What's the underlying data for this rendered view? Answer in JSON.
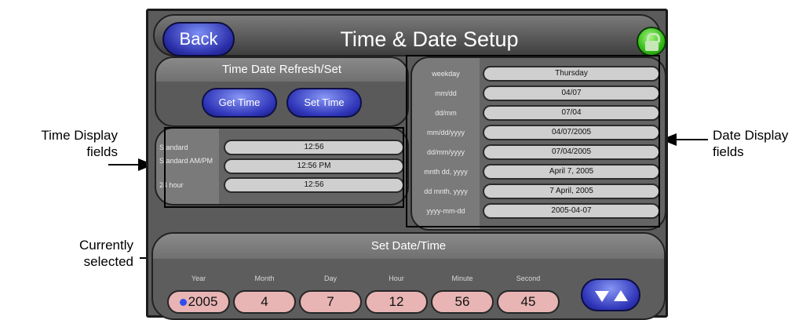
{
  "titlebar": {
    "back_label": "Back",
    "title": "Time & Date Setup",
    "lock_icon": "padlock-icon"
  },
  "refresh_panel": {
    "title": "Time Date Refresh/Set",
    "get_time_label": "Get Time",
    "set_time_label": "Set Time"
  },
  "time_display": {
    "rows": [
      {
        "label": "Standard",
        "value": "12:56"
      },
      {
        "label": "Standard AM/PM",
        "value": "12:56 PM"
      },
      {
        "label": "24 hour",
        "value": "12:56"
      }
    ]
  },
  "date_display": {
    "rows": [
      {
        "label": "weekday",
        "value": "Thursday"
      },
      {
        "label": "mm/dd",
        "value": "04/07"
      },
      {
        "label": "dd/mm",
        "value": "07/04"
      },
      {
        "label": "mm/dd/yyyy",
        "value": "04/07/2005"
      },
      {
        "label": "dd/mm/yyyy",
        "value": "07/04/2005"
      },
      {
        "label": "mnth dd, yyyy",
        "value": "April 7, 2005"
      },
      {
        "label": "dd mnth, yyyy",
        "value": "7 April, 2005"
      },
      {
        "label": "yyyy-mm-dd",
        "value": "2005-04-07"
      }
    ]
  },
  "set_panel": {
    "title": "Set Date/Time",
    "fields": [
      {
        "label": "Year",
        "value": "2005"
      },
      {
        "label": "Month",
        "value": "4"
      },
      {
        "label": "Day",
        "value": "7"
      },
      {
        "label": "Hour",
        "value": "12"
      },
      {
        "label": "Minute",
        "value": "56"
      },
      {
        "label": "Second",
        "value": "45"
      }
    ],
    "arrows_icon": "down-up-arrows-icon"
  },
  "callouts": {
    "time_display": "Time Display\nfields",
    "currently_selected": "Currently\nselected",
    "date_display": "Date Display\nfields"
  },
  "colors": {
    "accent_blue": "#2f35b8",
    "lock_green": "#31b915",
    "selected_field": "#e8b4b4"
  }
}
